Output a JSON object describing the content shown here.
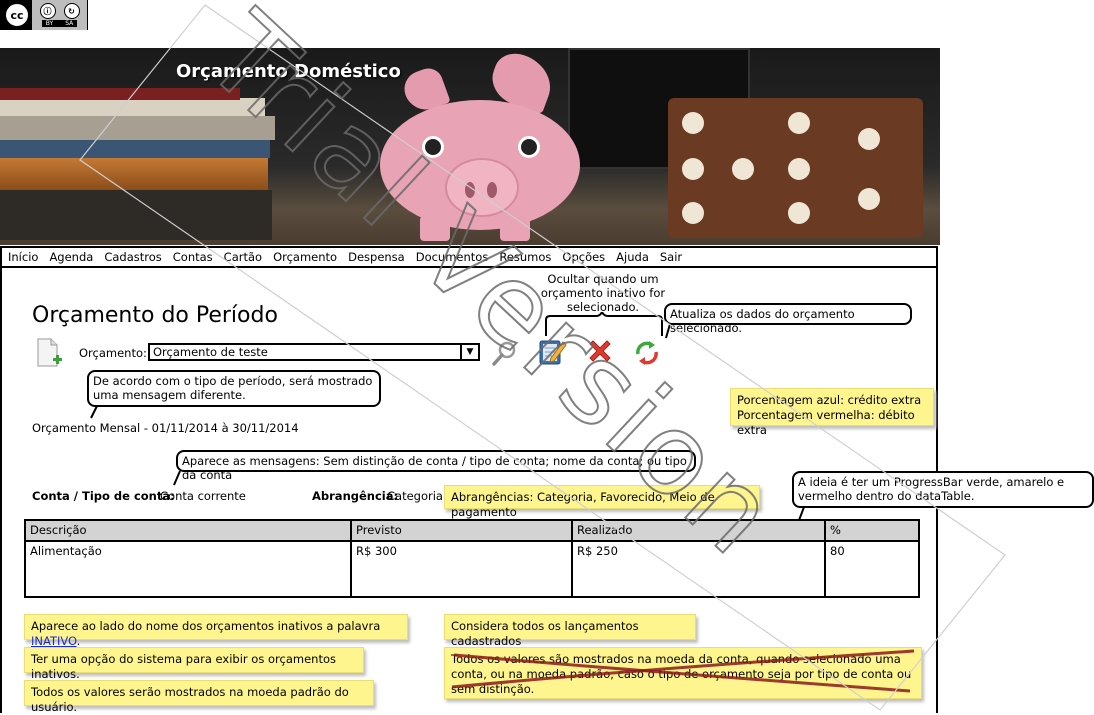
{
  "license": {
    "cc": "cc",
    "by": "BY",
    "sa": "SA"
  },
  "banner": {
    "title": "Orçamento Doméstico"
  },
  "menu": [
    "Início",
    "Agenda",
    "Cadastros",
    "Contas",
    "Cartão",
    "Orçamento",
    "Despensa",
    "Documentos",
    "Resumos",
    "Opções",
    "Ajuda",
    "Sair"
  ],
  "page": {
    "title": "Orçamento do Período",
    "budget_label": "Orçamento:",
    "budget_selected": "Orçamento de teste",
    "period": "Orçamento Mensal - 01/11/2014 à 30/11/2014",
    "account_label": "Conta / Tipo de conta:",
    "account_value": "Conta corrente",
    "scope_label": "Abrangência:",
    "scope_value": "Categoria"
  },
  "table": {
    "headers": [
      "Descrição",
      "Previsto",
      "Realizado",
      "%"
    ],
    "rows": [
      [
        "Alimentação",
        "R$ 300",
        "R$ 250",
        "80"
      ]
    ]
  },
  "callouts": {
    "hide_inactive": "Ocultar quando um orçamento inativo for selecionado.",
    "refresh": "Atualiza os dados do orçamento selecionado.",
    "period_msg": "De acordo com o tipo de período, será mostrado uma mensagem diferente.",
    "account_msg": "Aparece as mensagens: Sem distinção de conta / tipo de conta; nome da conta; ou tipo da conta",
    "progress": "A ideia é ter um ProgressBar verde, amarelo e vermelho dentro do dataTable."
  },
  "notes": {
    "percent_blue": "Porcentagem azul: crédito extra",
    "percent_red": "Porcentagem vermelha: débito extra",
    "scopes": "Abrangências: Categoria, Favorecido, Meio de pagamento",
    "inactive_prefix": "Aparece ao lado do nome dos orçamentos inativos a palavra ",
    "inactive_link": "INATIVO",
    "inactive_suffix": ".",
    "show_inactive_option": "Ter uma opção do sistema para exibir os orçamentos inativos.",
    "default_currency": "Todos os valores serão mostrados na moeda padrão do usuário.",
    "all_entries": "Considera todos os lançamentos cadastrados",
    "account_currency": "Todos os valores são mostrados na moeda da conta, quando selecionado uma conta, ou na moeda padrão, caso o tipo de orçamento seja por tipo de conta ou sem distinção."
  },
  "watermark": "Trial Version",
  "colors": {
    "sticky": "#fef58f",
    "header": "#d3d3d3",
    "strike": "#8b1a1a"
  }
}
